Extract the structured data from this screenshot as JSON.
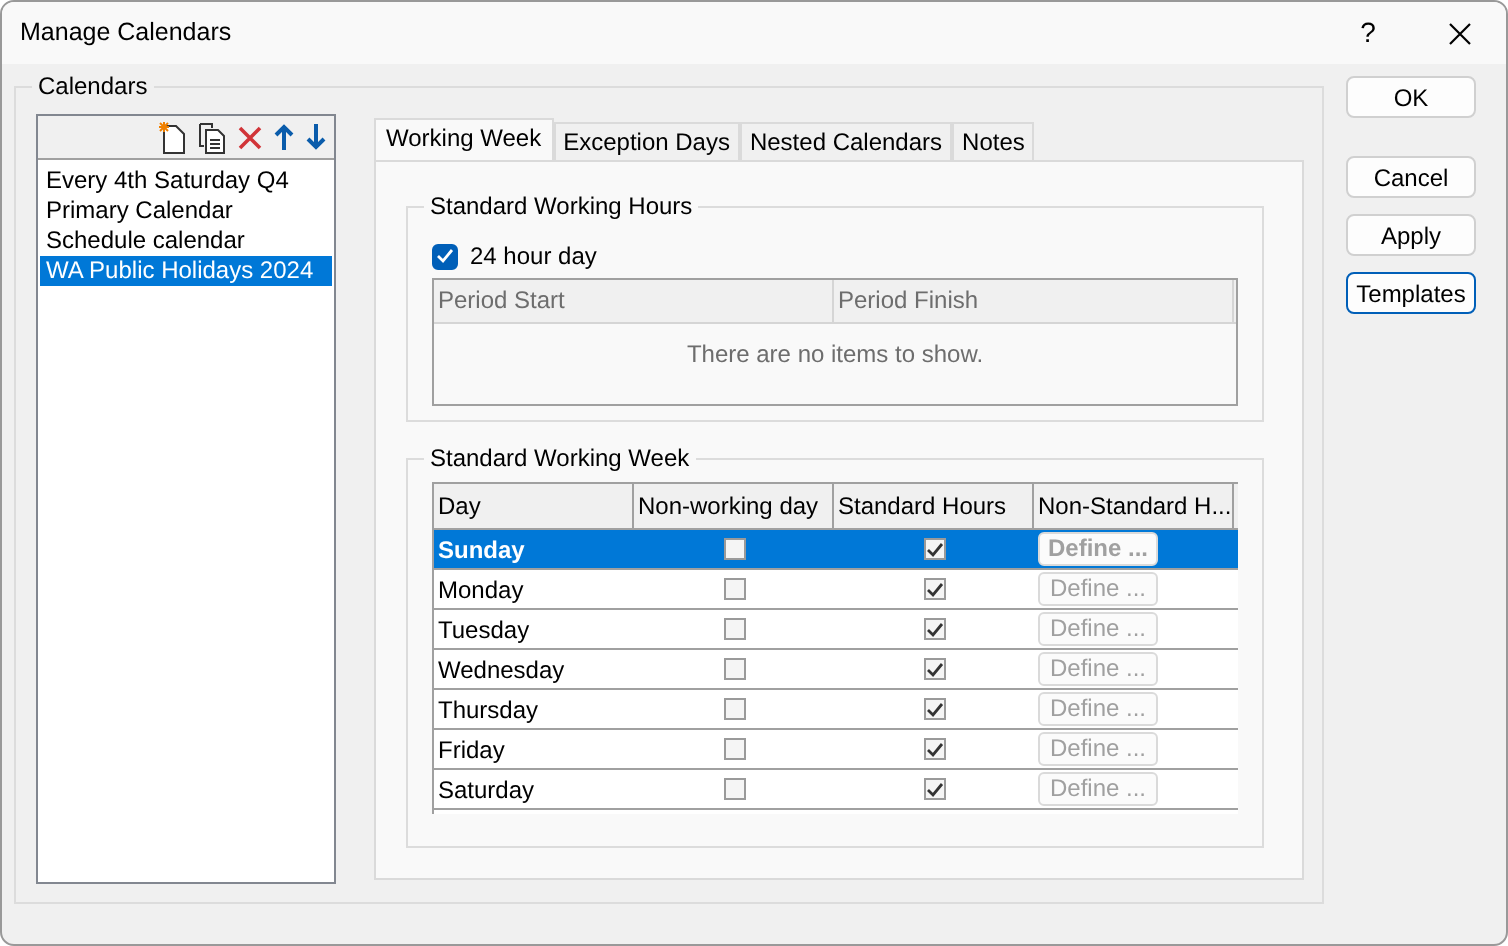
{
  "window": {
    "title": "Manage Calendars",
    "help": "?"
  },
  "calendars": {
    "legend": "Calendars",
    "items": [
      {
        "label": "Every 4th Saturday Q4",
        "selected": false
      },
      {
        "label": "Primary Calendar",
        "selected": false
      },
      {
        "label": "Schedule calendar",
        "selected": false
      },
      {
        "label": "WA Public Holidays 2024",
        "selected": true
      }
    ]
  },
  "tabs": [
    {
      "label": "Working Week",
      "selected": true
    },
    {
      "label": "Exception Days",
      "selected": false
    },
    {
      "label": "Nested Calendars",
      "selected": false
    },
    {
      "label": "Notes",
      "selected": false
    }
  ],
  "working_hours": {
    "legend": "Standard Working Hours",
    "all_day": {
      "label": "24 hour day",
      "checked": true
    },
    "columns": [
      "Period Start",
      "Period Finish"
    ],
    "empty_text": "There are no items to show."
  },
  "working_week": {
    "legend": "Standard Working Week",
    "columns": [
      "Day",
      "Non-working day",
      "Standard Hours",
      "Non-Standard H..."
    ],
    "rows": [
      {
        "day": "Sunday",
        "selected": true,
        "non_working": false,
        "standard_hours": true,
        "define": "Define ...",
        "define_disabled": true
      },
      {
        "day": "Monday",
        "selected": false,
        "non_working": false,
        "standard_hours": true,
        "define": "Define ...",
        "define_disabled": true
      },
      {
        "day": "Tuesday",
        "selected": false,
        "non_working": false,
        "standard_hours": true,
        "define": "Define ...",
        "define_disabled": true
      },
      {
        "day": "Wednesday",
        "selected": false,
        "non_working": false,
        "standard_hours": true,
        "define": "Define ...",
        "define_disabled": true
      },
      {
        "day": "Thursday",
        "selected": false,
        "non_working": false,
        "standard_hours": true,
        "define": "Define ...",
        "define_disabled": true
      },
      {
        "day": "Friday",
        "selected": false,
        "non_working": false,
        "standard_hours": true,
        "define": "Define ...",
        "define_disabled": true
      },
      {
        "day": "Saturday",
        "selected": false,
        "non_working": false,
        "standard_hours": true,
        "define": "Define ...",
        "define_disabled": true
      }
    ]
  },
  "buttons": [
    {
      "label": "OK",
      "focused": false
    },
    {
      "label": "Cancel",
      "focused": false
    },
    {
      "label": "Apply",
      "focused": false
    },
    {
      "label": "Templates",
      "focused": true
    }
  ]
}
